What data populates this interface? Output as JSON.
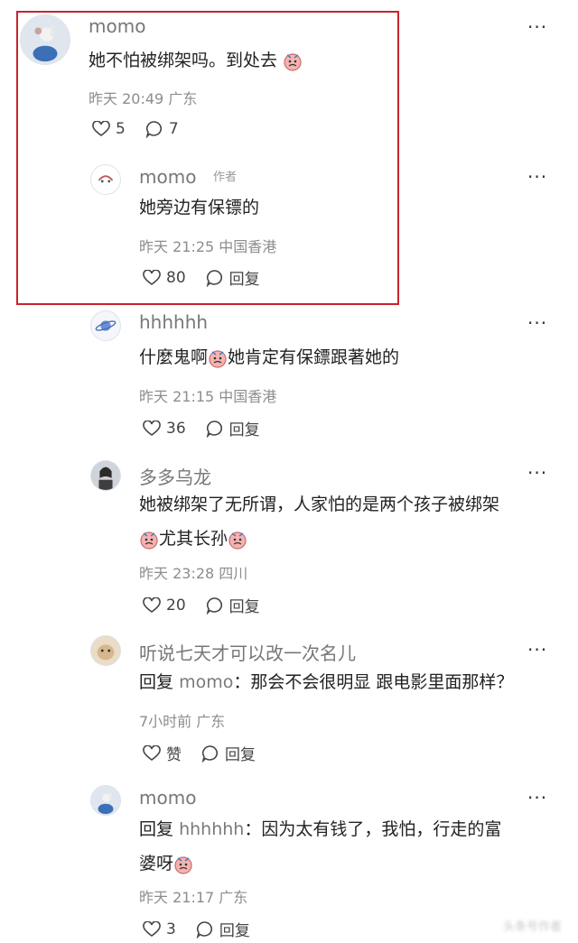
{
  "comments": [
    {
      "user": "momo",
      "text": "她不怕被绑架吗。到处去",
      "meta": "昨天 20:49 广东",
      "likes": "5",
      "replies": "7"
    },
    {
      "user": "momo",
      "author_tag": "作者",
      "text": "她旁边有保镖的",
      "meta": "昨天 21:25 中国香港",
      "likes": "80",
      "reply_label": "回复"
    },
    {
      "user": "hhhhhh",
      "text_a": "什麼鬼啊",
      "text_b": "她肯定有保鏢跟著她的",
      "meta": "昨天 21:15 中国香港",
      "likes": "36",
      "reply_label": "回复"
    },
    {
      "user": "多多乌龙",
      "text_line1": "她被绑架了无所谓，人家怕的是两个孩子被绑架",
      "text_line2": "尤其长孙",
      "meta": "昨天 23:28 四川",
      "likes": "20",
      "reply_label": "回复"
    },
    {
      "user": "听说七天才可以改一次名儿",
      "reply_prefix": "回复",
      "mention": "momo",
      "text": "：那会不会很明显 跟电影里面那样？",
      "meta": "7小时前 广东",
      "likes": "赞",
      "reply_label": "回复"
    },
    {
      "user": "momo",
      "reply_prefix": "回复",
      "mention": "hhhhhh",
      "text_line1": "：因为太有钱了，我怕，行走的富",
      "text_line2": "婆呀",
      "meta": "昨天 21:17 广东",
      "likes": "3",
      "reply_label": "回复"
    }
  ],
  "more_label": "···",
  "highlight_color": "#c8232c",
  "watermark": "头条号作者"
}
